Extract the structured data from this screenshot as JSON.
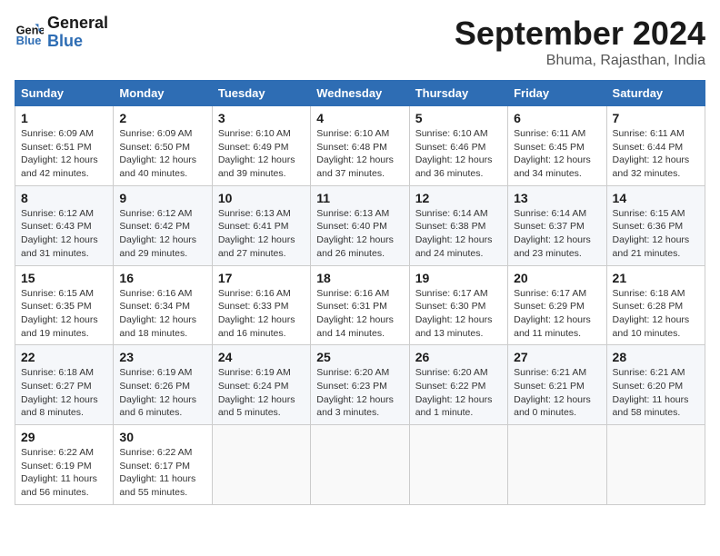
{
  "header": {
    "logo_line1": "General",
    "logo_line2": "Blue",
    "month_year": "September 2024",
    "location": "Bhuma, Rajasthan, India"
  },
  "days_of_week": [
    "Sunday",
    "Monday",
    "Tuesday",
    "Wednesday",
    "Thursday",
    "Friday",
    "Saturday"
  ],
  "weeks": [
    [
      {
        "num": "1",
        "detail": "Sunrise: 6:09 AM\nSunset: 6:51 PM\nDaylight: 12 hours\nand 42 minutes."
      },
      {
        "num": "2",
        "detail": "Sunrise: 6:09 AM\nSunset: 6:50 PM\nDaylight: 12 hours\nand 40 minutes."
      },
      {
        "num": "3",
        "detail": "Sunrise: 6:10 AM\nSunset: 6:49 PM\nDaylight: 12 hours\nand 39 minutes."
      },
      {
        "num": "4",
        "detail": "Sunrise: 6:10 AM\nSunset: 6:48 PM\nDaylight: 12 hours\nand 37 minutes."
      },
      {
        "num": "5",
        "detail": "Sunrise: 6:10 AM\nSunset: 6:46 PM\nDaylight: 12 hours\nand 36 minutes."
      },
      {
        "num": "6",
        "detail": "Sunrise: 6:11 AM\nSunset: 6:45 PM\nDaylight: 12 hours\nand 34 minutes."
      },
      {
        "num": "7",
        "detail": "Sunrise: 6:11 AM\nSunset: 6:44 PM\nDaylight: 12 hours\nand 32 minutes."
      }
    ],
    [
      {
        "num": "8",
        "detail": "Sunrise: 6:12 AM\nSunset: 6:43 PM\nDaylight: 12 hours\nand 31 minutes."
      },
      {
        "num": "9",
        "detail": "Sunrise: 6:12 AM\nSunset: 6:42 PM\nDaylight: 12 hours\nand 29 minutes."
      },
      {
        "num": "10",
        "detail": "Sunrise: 6:13 AM\nSunset: 6:41 PM\nDaylight: 12 hours\nand 27 minutes."
      },
      {
        "num": "11",
        "detail": "Sunrise: 6:13 AM\nSunset: 6:40 PM\nDaylight: 12 hours\nand 26 minutes."
      },
      {
        "num": "12",
        "detail": "Sunrise: 6:14 AM\nSunset: 6:38 PM\nDaylight: 12 hours\nand 24 minutes."
      },
      {
        "num": "13",
        "detail": "Sunrise: 6:14 AM\nSunset: 6:37 PM\nDaylight: 12 hours\nand 23 minutes."
      },
      {
        "num": "14",
        "detail": "Sunrise: 6:15 AM\nSunset: 6:36 PM\nDaylight: 12 hours\nand 21 minutes."
      }
    ],
    [
      {
        "num": "15",
        "detail": "Sunrise: 6:15 AM\nSunset: 6:35 PM\nDaylight: 12 hours\nand 19 minutes."
      },
      {
        "num": "16",
        "detail": "Sunrise: 6:16 AM\nSunset: 6:34 PM\nDaylight: 12 hours\nand 18 minutes."
      },
      {
        "num": "17",
        "detail": "Sunrise: 6:16 AM\nSunset: 6:33 PM\nDaylight: 12 hours\nand 16 minutes."
      },
      {
        "num": "18",
        "detail": "Sunrise: 6:16 AM\nSunset: 6:31 PM\nDaylight: 12 hours\nand 14 minutes."
      },
      {
        "num": "19",
        "detail": "Sunrise: 6:17 AM\nSunset: 6:30 PM\nDaylight: 12 hours\nand 13 minutes."
      },
      {
        "num": "20",
        "detail": "Sunrise: 6:17 AM\nSunset: 6:29 PM\nDaylight: 12 hours\nand 11 minutes."
      },
      {
        "num": "21",
        "detail": "Sunrise: 6:18 AM\nSunset: 6:28 PM\nDaylight: 12 hours\nand 10 minutes."
      }
    ],
    [
      {
        "num": "22",
        "detail": "Sunrise: 6:18 AM\nSunset: 6:27 PM\nDaylight: 12 hours\nand 8 minutes."
      },
      {
        "num": "23",
        "detail": "Sunrise: 6:19 AM\nSunset: 6:26 PM\nDaylight: 12 hours\nand 6 minutes."
      },
      {
        "num": "24",
        "detail": "Sunrise: 6:19 AM\nSunset: 6:24 PM\nDaylight: 12 hours\nand 5 minutes."
      },
      {
        "num": "25",
        "detail": "Sunrise: 6:20 AM\nSunset: 6:23 PM\nDaylight: 12 hours\nand 3 minutes."
      },
      {
        "num": "26",
        "detail": "Sunrise: 6:20 AM\nSunset: 6:22 PM\nDaylight: 12 hours\nand 1 minute."
      },
      {
        "num": "27",
        "detail": "Sunrise: 6:21 AM\nSunset: 6:21 PM\nDaylight: 12 hours\nand 0 minutes."
      },
      {
        "num": "28",
        "detail": "Sunrise: 6:21 AM\nSunset: 6:20 PM\nDaylight: 11 hours\nand 58 minutes."
      }
    ],
    [
      {
        "num": "29",
        "detail": "Sunrise: 6:22 AM\nSunset: 6:19 PM\nDaylight: 11 hours\nand 56 minutes."
      },
      {
        "num": "30",
        "detail": "Sunrise: 6:22 AM\nSunset: 6:17 PM\nDaylight: 11 hours\nand 55 minutes."
      },
      {
        "num": "",
        "detail": ""
      },
      {
        "num": "",
        "detail": ""
      },
      {
        "num": "",
        "detail": ""
      },
      {
        "num": "",
        "detail": ""
      },
      {
        "num": "",
        "detail": ""
      }
    ]
  ]
}
